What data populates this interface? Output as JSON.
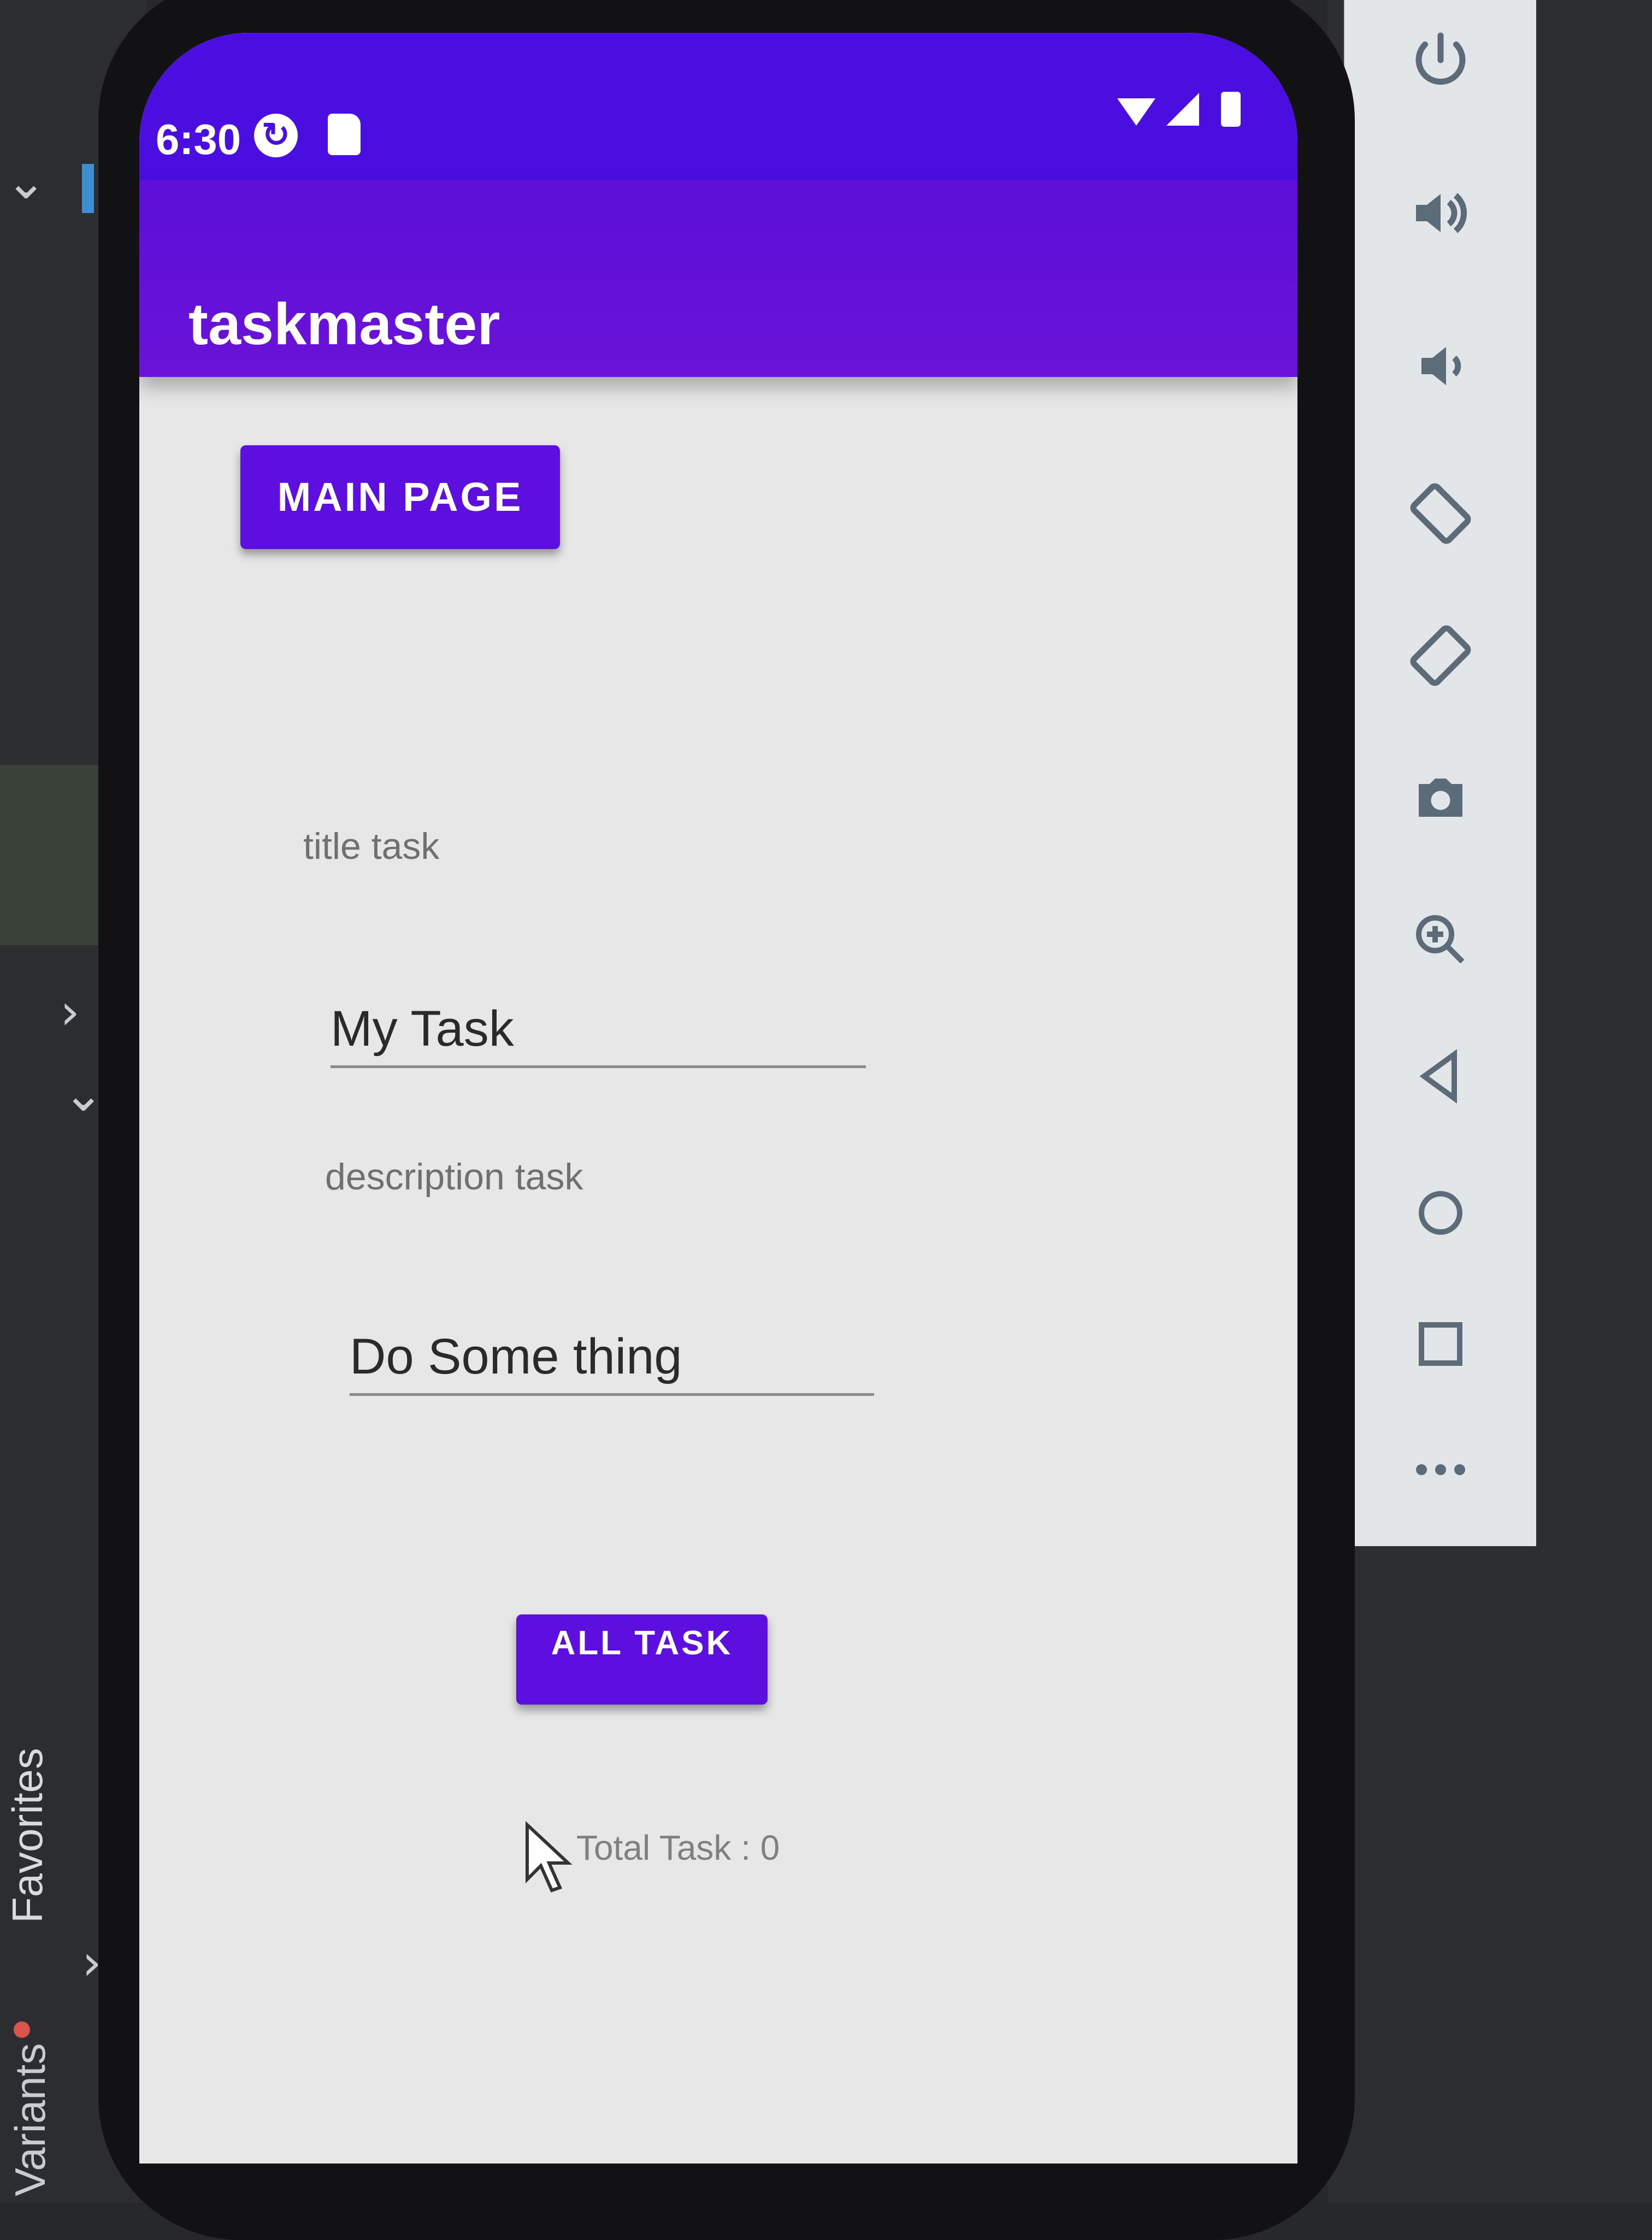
{
  "status_bar": {
    "time": "6:30"
  },
  "app": {
    "title": "taskmaster"
  },
  "buttons": {
    "main_page": "MAIN PAGE",
    "all_task": "ALL TASK"
  },
  "form": {
    "title_label": "title task",
    "title_value": "My Task",
    "description_label": "description task",
    "description_value": "Do Some thing"
  },
  "footer": {
    "total_tasks": "Total Task : 0"
  },
  "ide": {
    "side_tab_variants": "Variants",
    "side_tab_favorites": "Favorites"
  },
  "emulator_toolbar": {
    "icons": [
      "power-icon",
      "volume-up-icon",
      "volume-down-icon",
      "rotate-left-icon",
      "rotate-right-icon",
      "camera-icon",
      "zoom-icon",
      "back-icon",
      "home-icon",
      "overview-icon",
      "more-icon"
    ]
  },
  "colors": {
    "primary": "#5d0fe0",
    "status_bar": "#4a0ee0",
    "screen_background": "#e6e7e6"
  }
}
